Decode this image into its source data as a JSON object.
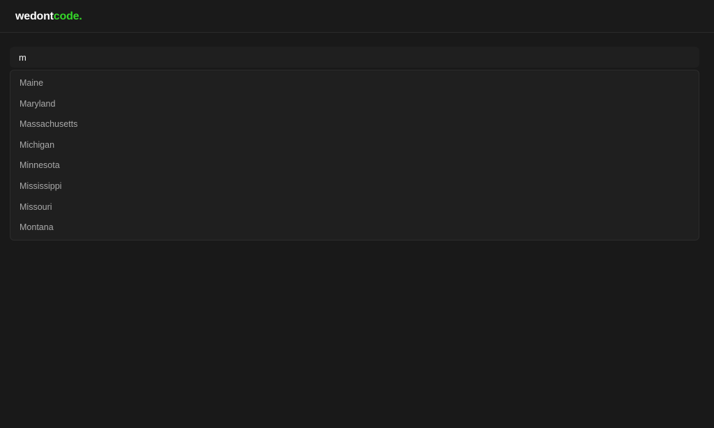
{
  "header": {
    "logo_part1": "wedont",
    "logo_part2": "code."
  },
  "colors": {
    "background": "#191919",
    "accent": "#35d629",
    "text": "#ffffff",
    "muted_text": "#a9a9a9"
  },
  "search": {
    "value": "m"
  },
  "dropdown": {
    "options": [
      "Maine",
      "Maryland",
      "Massachusetts",
      "Michigan",
      "Minnesota",
      "Mississippi",
      "Missouri",
      "Montana"
    ]
  }
}
